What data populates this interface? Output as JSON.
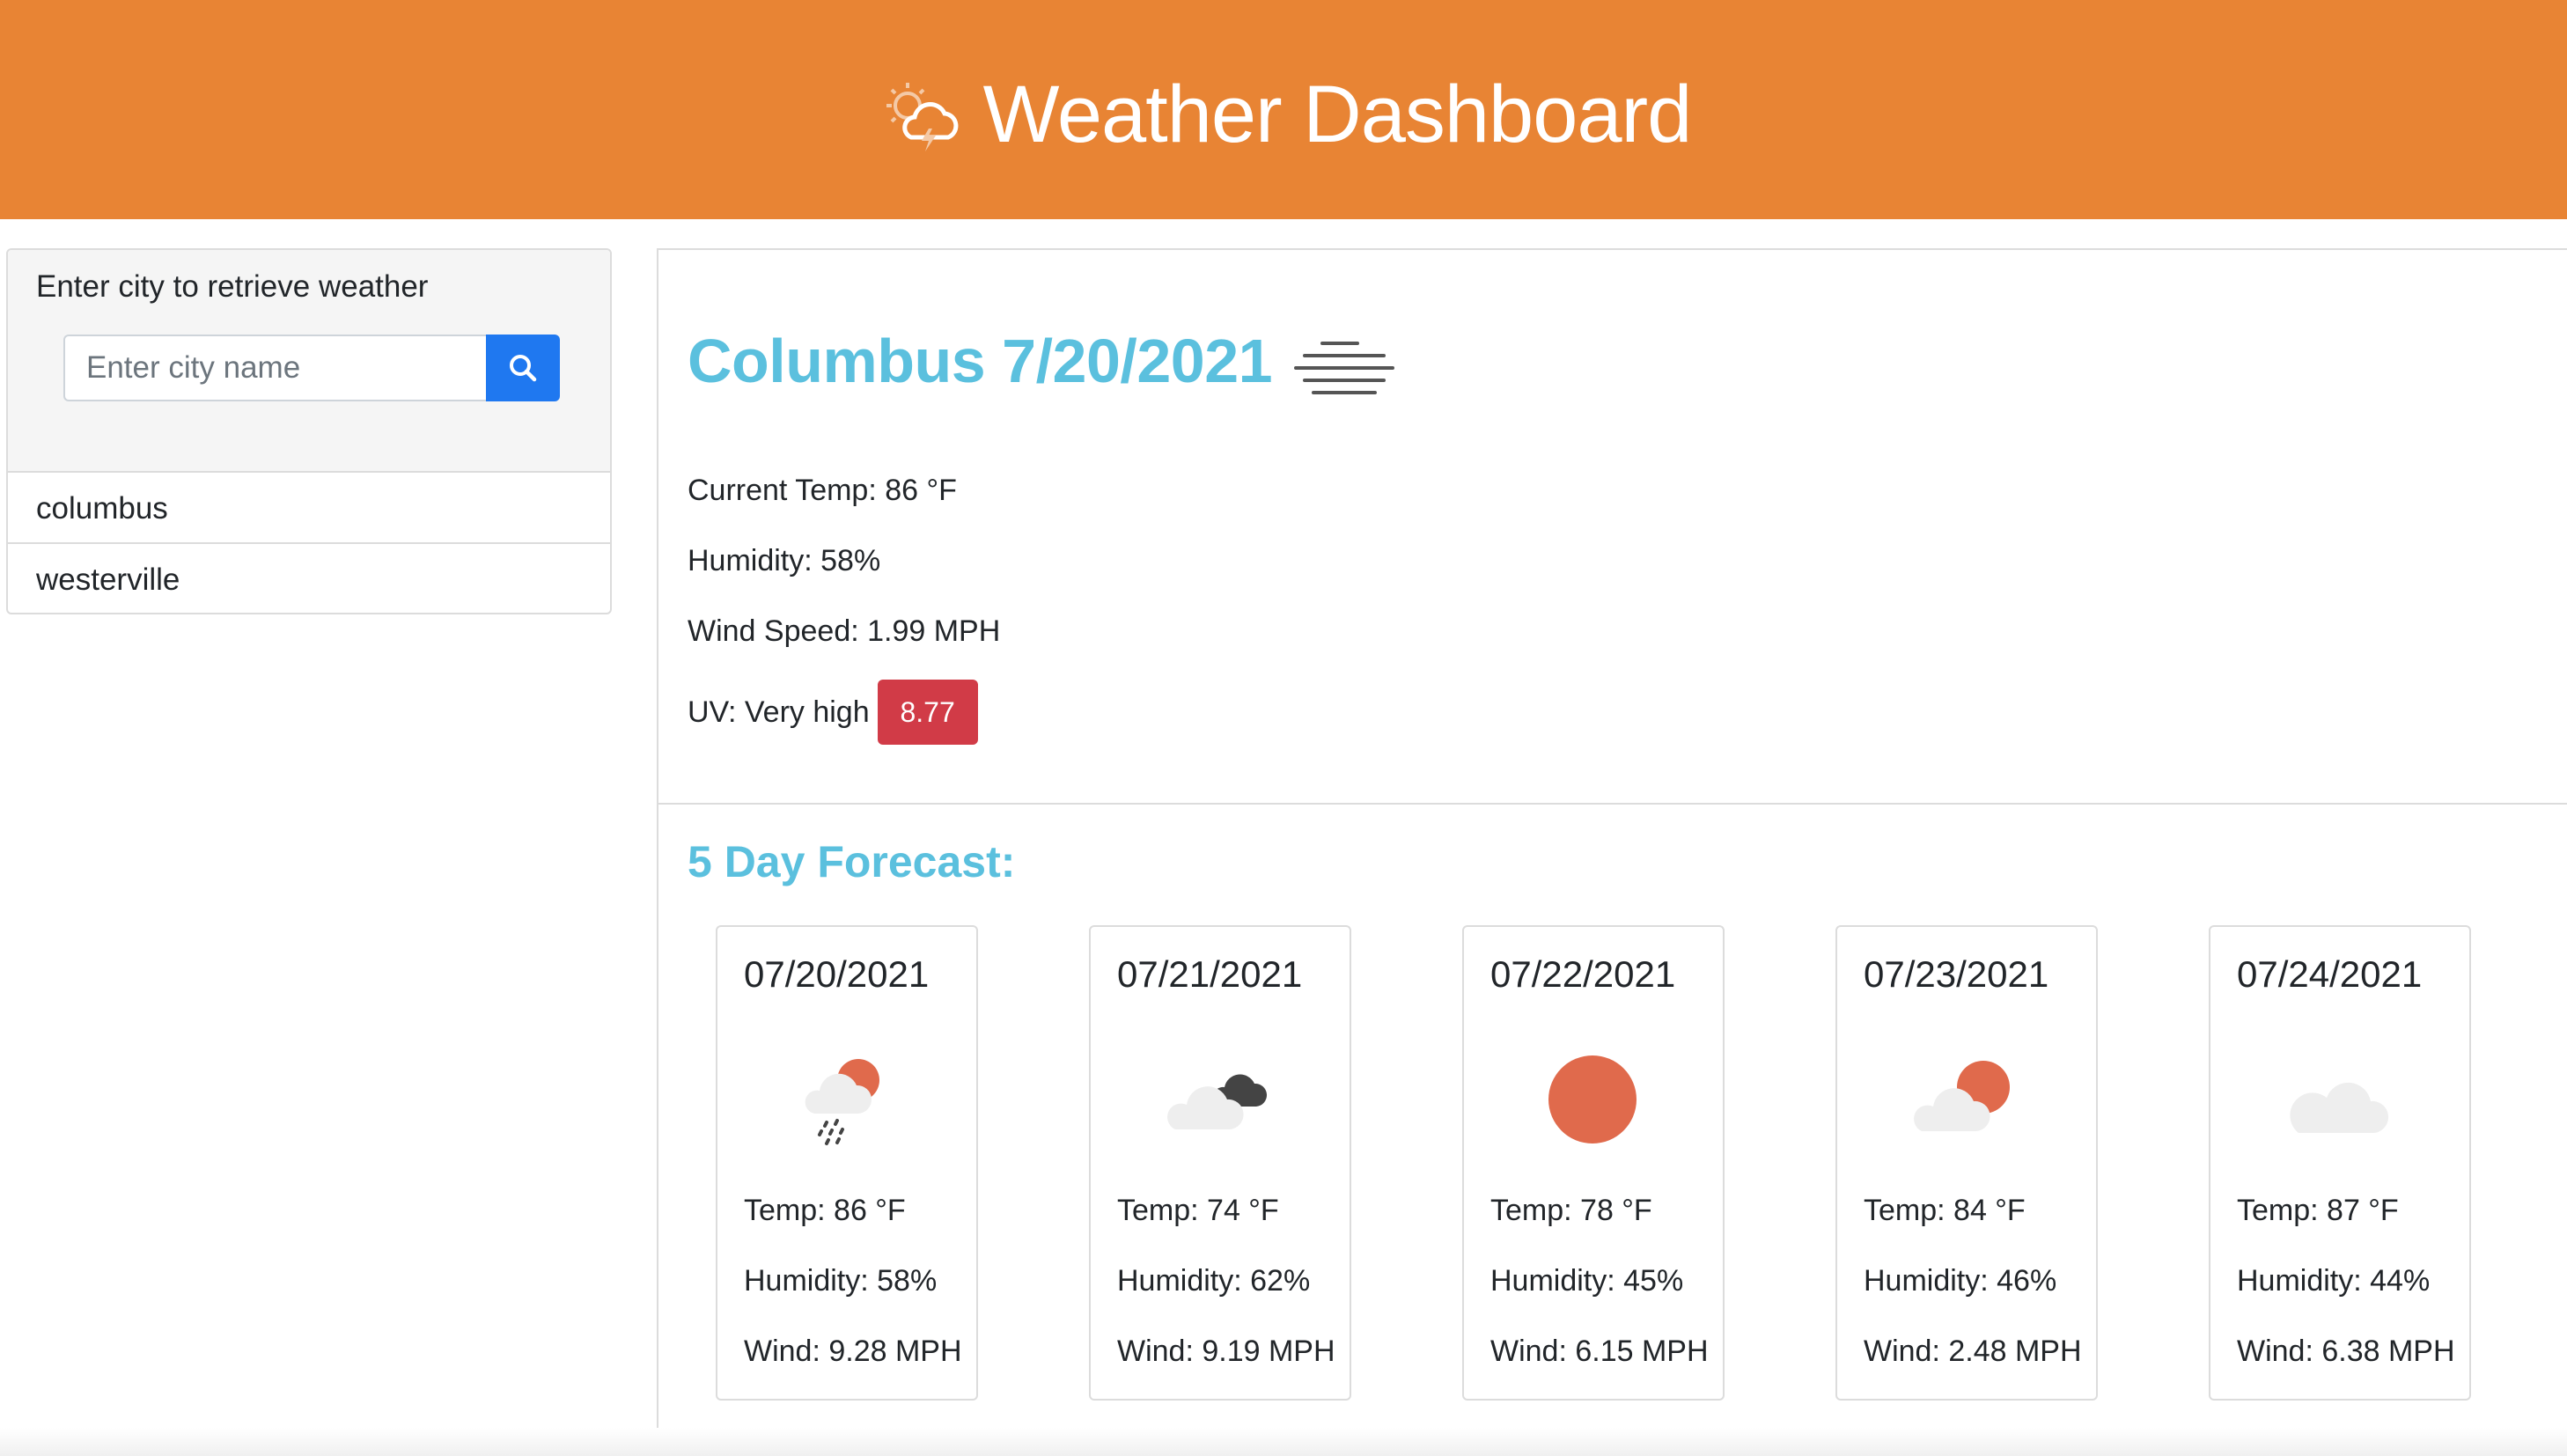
{
  "header": {
    "title": "Weather Dashboard",
    "logo_icon": "sun-cloud-lightning-icon"
  },
  "sidebar": {
    "prompt": "Enter city to retrieve weather",
    "search_placeholder": "Enter city name",
    "search_button_icon": "search-icon",
    "history": [
      {
        "label": "columbus"
      },
      {
        "label": "westerville"
      }
    ]
  },
  "current": {
    "title": "Columbus 7/20/2021",
    "condition_icon": "mist-icon",
    "temp": "Current Temp: 86 °F",
    "humidity": "Humidity: 58%",
    "wind": "Wind Speed: 1.99 MPH",
    "uv_label": "UV: Very high",
    "uv_value": "8.77",
    "uv_color": "#d13b47"
  },
  "forecast": {
    "title": "5 Day Forecast:",
    "days": [
      {
        "date": "07/20/2021",
        "icon": "rain-sun-cloud-icon",
        "temp": "Temp: 86 °F",
        "humidity": "Humidity: 58%",
        "wind": "Wind: 9.28 MPH"
      },
      {
        "date": "07/21/2021",
        "icon": "broken-clouds-icon",
        "temp": "Temp: 74 °F",
        "humidity": "Humidity: 62%",
        "wind": "Wind: 9.19 MPH"
      },
      {
        "date": "07/22/2021",
        "icon": "clear-sun-icon",
        "temp": "Temp: 78 °F",
        "humidity": "Humidity: 45%",
        "wind": "Wind: 6.15 MPH"
      },
      {
        "date": "07/23/2021",
        "icon": "partly-cloudy-icon",
        "temp": "Temp: 84 °F",
        "humidity": "Humidity: 46%",
        "wind": "Wind: 2.48 MPH"
      },
      {
        "date": "07/24/2021",
        "icon": "cloud-icon",
        "temp": "Temp: 87 °F",
        "humidity": "Humidity: 44%",
        "wind": "Wind: 6.38 MPH"
      }
    ]
  },
  "colors": {
    "header_bg": "#e88434",
    "accent": "#5bc0de",
    "search_button": "#1f78f0",
    "sun": "#e06a4c"
  }
}
